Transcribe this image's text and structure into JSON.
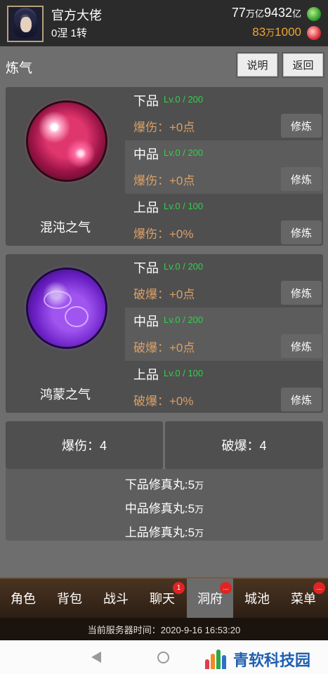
{
  "header": {
    "name": "官方大佬",
    "rank": "0涅 1转",
    "res1": {
      "a": "77",
      "a_unit": "万亿",
      "b": "9432",
      "b_unit": "亿"
    },
    "res2": {
      "a": "83",
      "a_unit": "万",
      "b": "1000"
    }
  },
  "title": {
    "text": "炼气",
    "explain": "说明",
    "back": "返回"
  },
  "panels": [
    {
      "name": "混沌之气",
      "rows": [
        {
          "grade": "下品",
          "lv": "Lv.0 / 200",
          "effect": "爆伤：+0点",
          "button": "修炼"
        },
        {
          "grade": "中品",
          "lv": "Lv.0 / 200",
          "effect": "爆伤：+0点",
          "button": "修炼"
        },
        {
          "grade": "上品",
          "lv": "Lv.0 / 100",
          "effect": "爆伤：+0%",
          "button": "修炼"
        }
      ]
    },
    {
      "name": "鸿蒙之气",
      "rows": [
        {
          "grade": "下品",
          "lv": "Lv.0 / 200",
          "effect": "破爆：+0点",
          "button": "修炼"
        },
        {
          "grade": "中品",
          "lv": "Lv.0 / 200",
          "effect": "破爆：+0点",
          "button": "修炼"
        },
        {
          "grade": "上品",
          "lv": "Lv.0 / 100",
          "effect": "破爆：+0%",
          "button": "修炼"
        }
      ]
    }
  ],
  "summary": {
    "left": "爆伤：4",
    "right": "破爆：4"
  },
  "pills": [
    {
      "label": "下品修真丸:5",
      "unit": "万"
    },
    {
      "label": "中品修真丸:5",
      "unit": "万"
    },
    {
      "label": "上品修真丸:5",
      "unit": "万"
    }
  ],
  "nav": [
    {
      "label": "角色"
    },
    {
      "label": "背包"
    },
    {
      "label": "战斗"
    },
    {
      "label": "聊天",
      "badge": "1"
    },
    {
      "label": "洞府",
      "badge": "...",
      "active": true
    },
    {
      "label": "城池"
    },
    {
      "label": "菜单",
      "badge": "..."
    }
  ],
  "server_time": "当前服务器时间：2020-9-16 16:53:20",
  "watermark": "青软科技园",
  "colors": {
    "level_green": "#32d04a",
    "effect_orange": "#dba067",
    "gold": "#f0a532"
  }
}
